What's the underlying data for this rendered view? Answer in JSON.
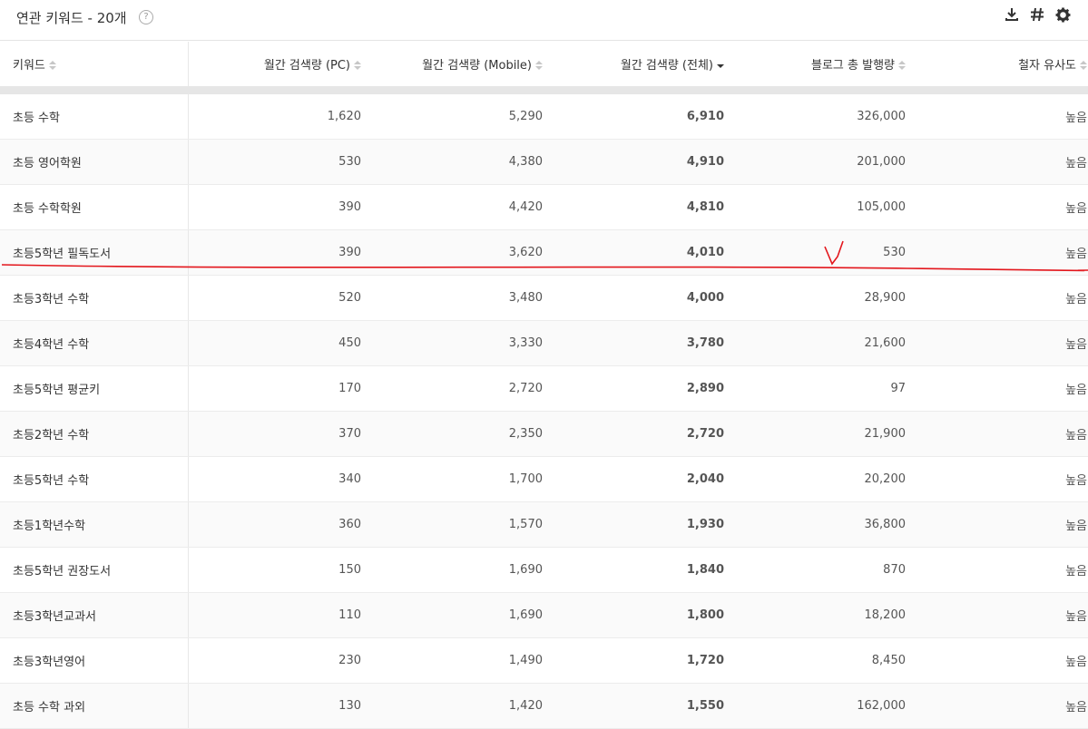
{
  "header": {
    "title": "연관 키워드 - 20개",
    "help_glyph": "?",
    "icons": [
      "download-icon",
      "hashtag-icon",
      "gear-icon"
    ]
  },
  "table": {
    "columns": [
      "키워드",
      "월간 검색량 (PC)",
      "월간 검색량 (Mobile)",
      "월간 검색량 (전체)",
      "블로그 총 발행량",
      "철자 유사도"
    ],
    "sorted_column": "월간 검색량 (전체)",
    "rows": [
      {
        "keyword": "초등 수학",
        "pc": "1,620",
        "mobile": "5,290",
        "total": "6,910",
        "blog": "326,000",
        "similarity": "높음"
      },
      {
        "keyword": "초등 영어학원",
        "pc": "530",
        "mobile": "4,380",
        "total": "4,910",
        "blog": "201,000",
        "similarity": "높음"
      },
      {
        "keyword": "초등 수학학원",
        "pc": "390",
        "mobile": "4,420",
        "total": "4,810",
        "blog": "105,000",
        "similarity": "높음"
      },
      {
        "keyword": "초등5학년 필독도서",
        "pc": "390",
        "mobile": "3,620",
        "total": "4,010",
        "blog": "530",
        "similarity": "높음"
      },
      {
        "keyword": "초등3학년 수학",
        "pc": "520",
        "mobile": "3,480",
        "total": "4,000",
        "blog": "28,900",
        "similarity": "높음"
      },
      {
        "keyword": "초등4학년 수학",
        "pc": "450",
        "mobile": "3,330",
        "total": "3,780",
        "blog": "21,600",
        "similarity": "높음"
      },
      {
        "keyword": "초등5학년 평균키",
        "pc": "170",
        "mobile": "2,720",
        "total": "2,890",
        "blog": "97",
        "similarity": "높음"
      },
      {
        "keyword": "초등2학년 수학",
        "pc": "370",
        "mobile": "2,350",
        "total": "2,720",
        "blog": "21,900",
        "similarity": "높음"
      },
      {
        "keyword": "초등5학년 수학",
        "pc": "340",
        "mobile": "1,700",
        "total": "2,040",
        "blog": "20,200",
        "similarity": "높음"
      },
      {
        "keyword": "초등1학년수학",
        "pc": "360",
        "mobile": "1,570",
        "total": "1,930",
        "blog": "36,800",
        "similarity": "높음"
      },
      {
        "keyword": "초등5학년 권장도서",
        "pc": "150",
        "mobile": "1,690",
        "total": "1,840",
        "blog": "870",
        "similarity": "높음"
      },
      {
        "keyword": "초등3학년교과서",
        "pc": "110",
        "mobile": "1,690",
        "total": "1,800",
        "blog": "18,200",
        "similarity": "높음"
      },
      {
        "keyword": "초등3학년영어",
        "pc": "230",
        "mobile": "1,490",
        "total": "1,720",
        "blog": "8,450",
        "similarity": "높음"
      },
      {
        "keyword": "초등 수학 과외",
        "pc": "130",
        "mobile": "1,420",
        "total": "1,550",
        "blog": "162,000",
        "similarity": "높음"
      }
    ]
  },
  "annotation": {
    "color": "#e3161c"
  }
}
